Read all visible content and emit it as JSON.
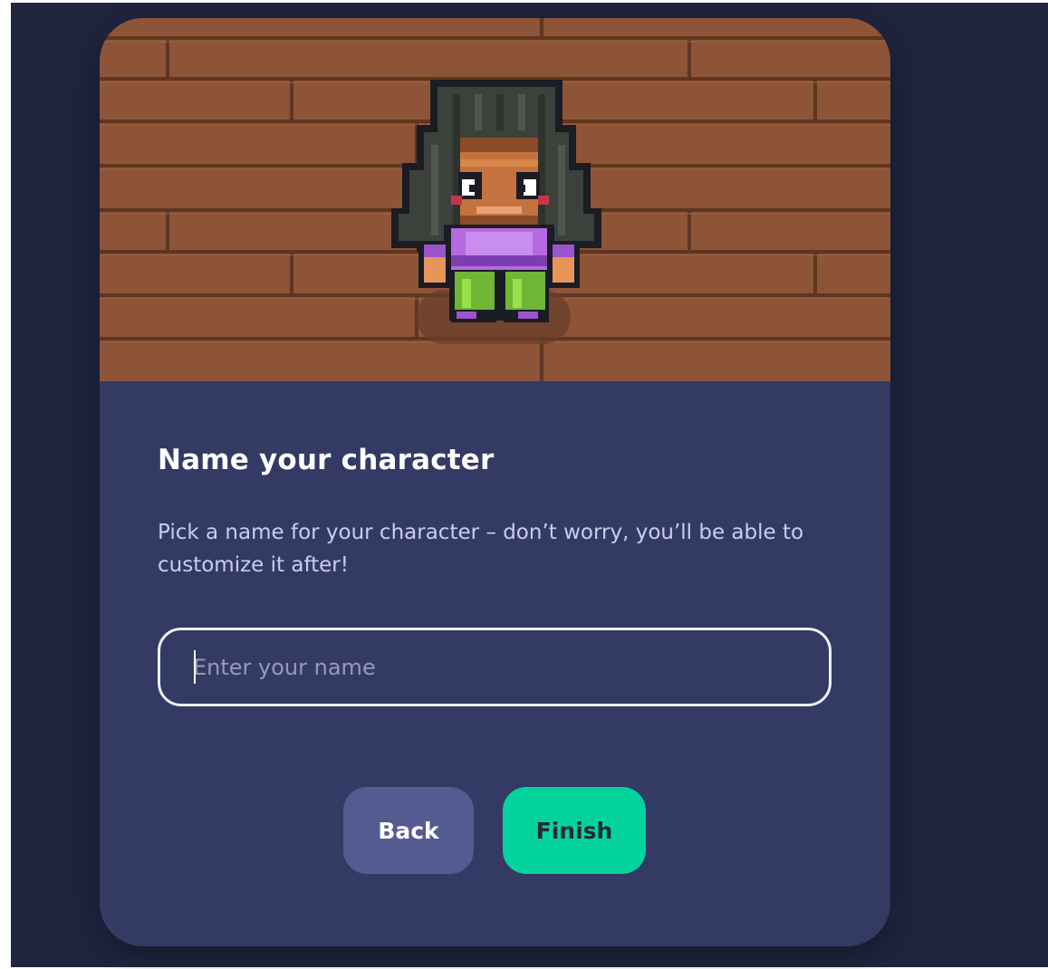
{
  "dialog": {
    "title": "Name your character",
    "description": "Pick a name for your character – don’t worry, you’ll be able to customize it after!",
    "name_input": {
      "placeholder": "Enter your name",
      "value": ""
    },
    "back_label": "Back",
    "finish_label": "Finish"
  },
  "colors": {
    "page_background": "#202540",
    "card_background": "#333a63",
    "floor": "#8e5437",
    "back_button": "#545b90",
    "finish_button": "#05d39e"
  },
  "scene": {
    "floor": "wood-plank-floor",
    "avatar": "pixel-character-avatar"
  }
}
